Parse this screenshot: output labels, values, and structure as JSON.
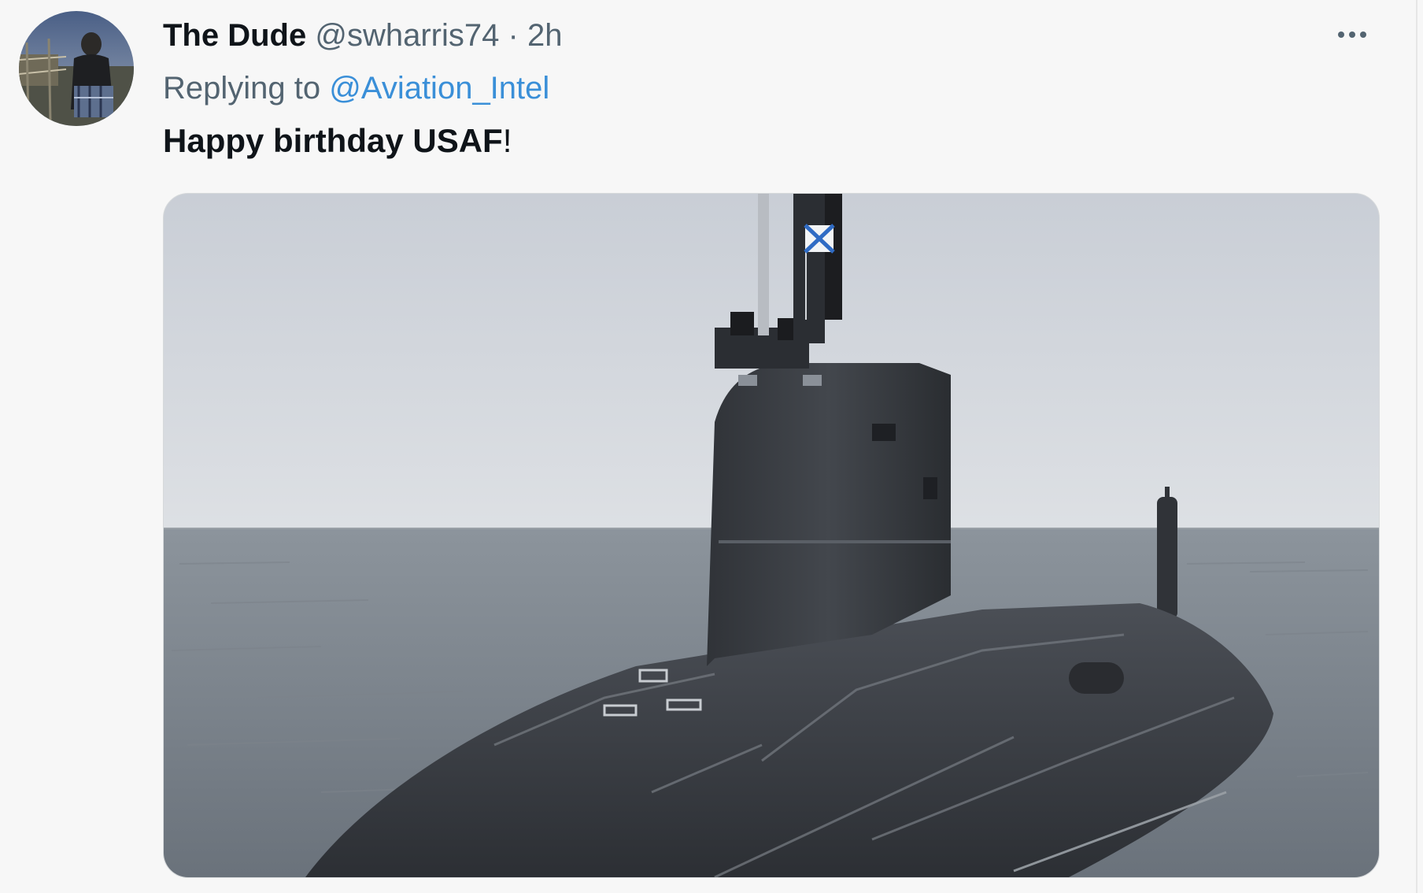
{
  "tweet": {
    "display_name": "The Dude",
    "handle": "@swharris74",
    "separator": "·",
    "time": "2h",
    "replying_prefix": "Replying to",
    "replying_to": "@Aviation_Intel",
    "text_main": "Happy birthday USAF",
    "text_suffix": "!",
    "more_icon": "more-horizontal-icon",
    "avatar": "user-avatar",
    "media": "photo-submarine-surfaced-at-sea"
  },
  "colors": {
    "background": "#f7f7f7",
    "primary_text": "#0f1419",
    "secondary_text": "#536471",
    "link": "#3a8fd8"
  }
}
